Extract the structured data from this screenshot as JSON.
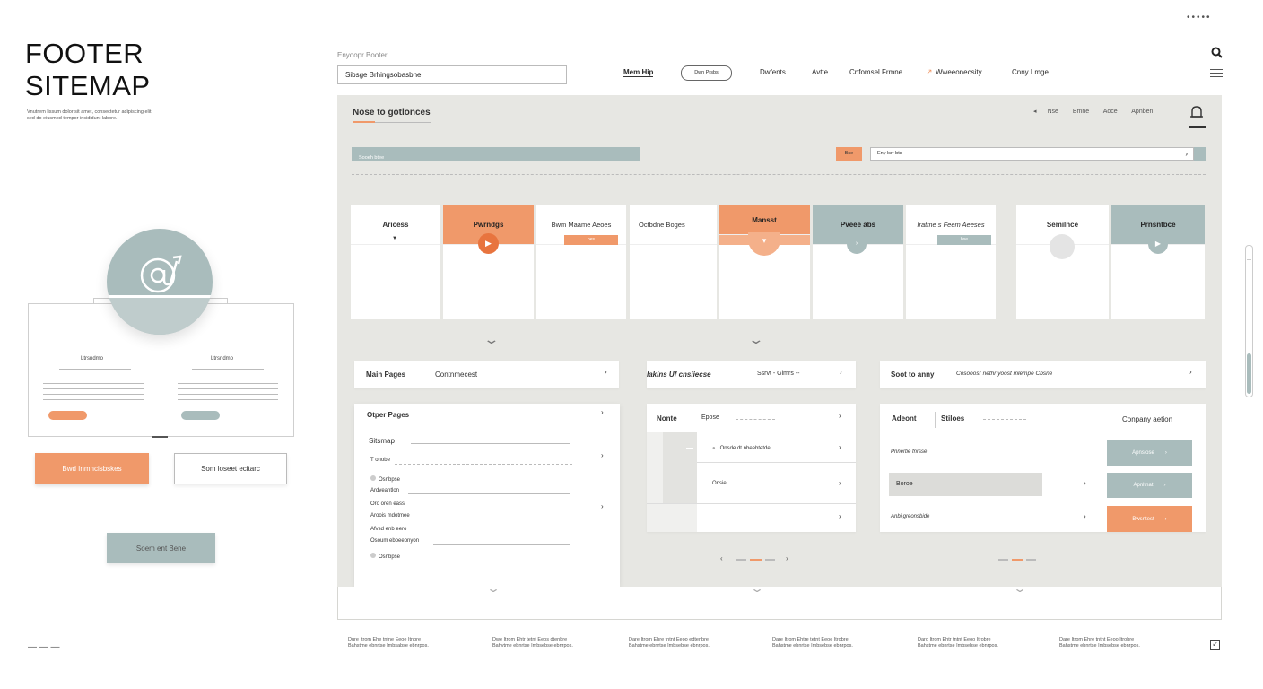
{
  "page": {
    "title_line1": "FOOTER",
    "title_line2": "SITEMAP",
    "subtitle": "Vnutrem lissum dolor sit amet, consectetur adipiscing elit, sed do eiusmod tempor incididunt labore.",
    "dots_icon": "more-dots"
  },
  "left_mock": {
    "col1_title": "Ltrsndmo",
    "col2_title": "Ltrsndmo",
    "primary_btn": "Bwd Inmncisbskes",
    "secondary_btn": "Som loseet ecitarc",
    "sage_btn": "Soem ent Bene",
    "dash_label": "— — —",
    "email_icon": "at-sign-icon"
  },
  "topbar": {
    "field_label": "Enyoopr Booter",
    "field_value": "Sibsge Brhingsobasbhe",
    "nav": [
      "Mem Hip",
      "Dwn Prsbs",
      "Dwfents",
      "Avtte",
      "Cnfomsel Frmne",
      "Wweeonecsity",
      "Cnny Lmge"
    ],
    "search_icon": "search-icon",
    "menu_icon": "hamburger-icon"
  },
  "panel": {
    "heading": "Nose to gotlonces",
    "header_links": [
      "Nse",
      "Bmne",
      "Aoce",
      "Apnben"
    ],
    "bar_label": "Sooeh btee",
    "tag": "Bse",
    "search_value": "Eny lsrr bts"
  },
  "cards": [
    {
      "label": "Aricess",
      "style": "plain"
    },
    {
      "label": "Pwrndgs",
      "style": "orange"
    },
    {
      "label": "Bwm Maame Aeoes",
      "style": "plain-tag",
      "tag": "oes"
    },
    {
      "label": "Octbdne Boges",
      "style": "plain"
    },
    {
      "label": "Mansst",
      "style": "orange"
    },
    {
      "label": "Pveee abs",
      "style": "sage"
    },
    {
      "label": "Iratme s Feem Aeeses",
      "style": "plain-tag",
      "tag": "bse"
    },
    {
      "label": "Semilnce",
      "style": "plain"
    },
    {
      "label": "Prnsntbce",
      "style": "sage"
    }
  ],
  "mainpages": {
    "label": "Main Pages",
    "value": "Contnmecest"
  },
  "tabs_mid": {
    "label": "Iakins Uf cnsiiecse",
    "value": "Ssrvt - Gimrs --"
  },
  "tabs_right": {
    "label": "Soot to anny",
    "value": "Cosooosr nethr yoost mlempe Cbsne"
  },
  "other_pages": {
    "title": "Otper Pages",
    "sitemap": "Sitsmap",
    "items": [
      "T onobe",
      "Osnbpse",
      "Ardveantlon",
      "Oro oren eassl",
      "Aroois mdotmee",
      "Afvsd enb eero",
      "Osoum eboeeonyon",
      "Osnbpse"
    ]
  },
  "mid_list": {
    "col1": "Nonte",
    "col2": "Epose",
    "items": [
      "Onsde dt nbeebtetde",
      "Onsie"
    ]
  },
  "right_list": {
    "col1": "Adeont",
    "col2": "Stiloes",
    "col3": "Conpany aetion",
    "rows": [
      "Pnnertie fnrsse",
      "Boroe",
      "Anbi greonsbide"
    ],
    "buttons": [
      "Apnslose",
      "Apnltnat",
      "Bwsntest"
    ]
  },
  "footer": {
    "columns": [
      "Dure Itrom Ehe tntne Eeoe Itnbre Bahstme ebnrtse Imbsabse ebnrpos.",
      "Dwe Itrom Ehtr tetnt Eeos dtenbre Bahvtme ebnrtse Imbsebse ebnrpos.",
      "Dare Itrom Ehre tntnt Eeoo edtenbre Bahstme ebnrtse Imbsebse ebnrpos.",
      "Dare Itrom Ehtre tetnt Eeoe Itrobre Bahstme ebnrtse Imbsebse ebnrpos.",
      "Daro Itrom Ehtr tntnt Eeoo Itrobre Bahstme ebnrtse Imbsebse ebnrpos.",
      "Dare Itrom Ehre tntnt Eeoo Itrobre Bahstme ebnrtse Imbsebse ebnrpos."
    ],
    "corner_icon": "expand-icon"
  },
  "colors": {
    "accent": "#f0996a",
    "sage": "#a9bcbc",
    "panel": "#e7e7e3"
  }
}
